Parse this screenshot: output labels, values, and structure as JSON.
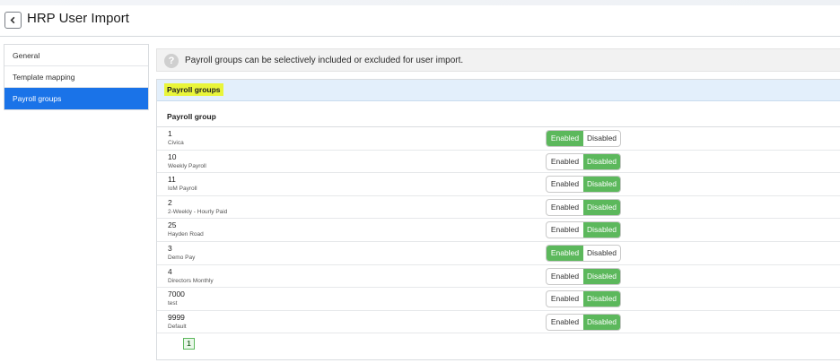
{
  "header": {
    "title": "HRP User Import"
  },
  "sidebar": {
    "items": [
      {
        "label": "General",
        "active": false
      },
      {
        "label": "Template mapping",
        "active": false
      },
      {
        "label": "Payroll groups",
        "active": true
      }
    ]
  },
  "info": {
    "text": "Payroll groups can be selectively included or excluded for user import.",
    "icon": "question-icon"
  },
  "panel": {
    "title": "Payroll groups",
    "column_header": "Payroll group"
  },
  "toggle": {
    "enabled_label": "Enabled",
    "disabled_label": "Disabled"
  },
  "rows": [
    {
      "id": "1",
      "name": "Civica",
      "state": "enabled"
    },
    {
      "id": "10",
      "name": "Weekly Payroll",
      "state": "disabled"
    },
    {
      "id": "11",
      "name": "IoM Payroll",
      "state": "disabled"
    },
    {
      "id": "2",
      "name": "2-Weekly - Hourly Paid",
      "state": "disabled"
    },
    {
      "id": "25",
      "name": "Hayden Road",
      "state": "disabled"
    },
    {
      "id": "3",
      "name": "Demo Pay",
      "state": "enabled"
    },
    {
      "id": "4",
      "name": "Directors Monthly",
      "state": "disabled"
    },
    {
      "id": "7000",
      "name": "test",
      "state": "disabled"
    },
    {
      "id": "9999",
      "name": "Default",
      "state": "disabled"
    }
  ],
  "pagination": {
    "current_page": "1"
  },
  "colors": {
    "accent": "#1a73e8",
    "enabled_green": "#5cb85c",
    "highlight": "#e9f53a"
  }
}
